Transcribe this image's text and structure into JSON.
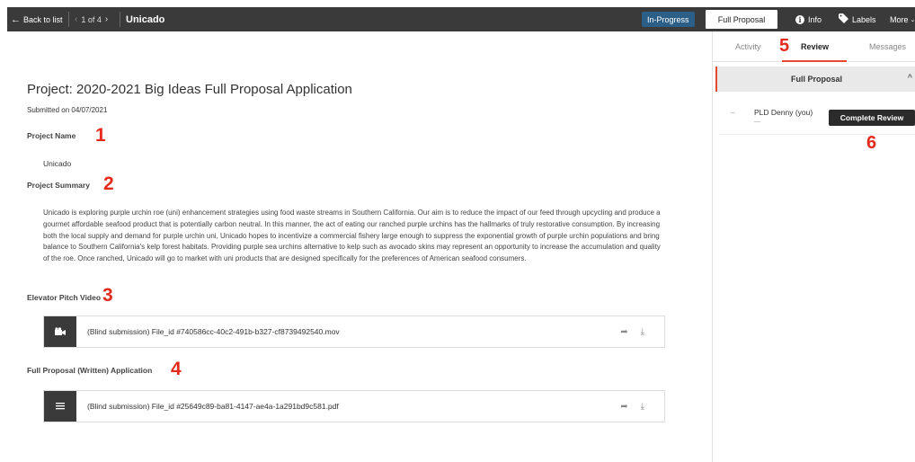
{
  "topbar": {
    "back_label": "Back to list",
    "pager_label": "1 of 4",
    "app_title": "Unicado",
    "status": "In-Progress",
    "full_proposal_label": "Full Proposal",
    "info_label": "Info",
    "labels_label": "Labels",
    "more_label": "More"
  },
  "content": {
    "title": "Project: 2020-2021 Big Ideas Full Proposal Application",
    "submitted": "Submitted on 04/07/2021",
    "project_name_heading": "Project Name",
    "project_name_value": "Unicado",
    "project_summary_heading": "Project Summary",
    "project_summary_text": "Unicado is exploring purple urchin roe (uni) enhancement strategies using food waste streams in Southern California. Our aim is to reduce the impact of our feed through upcycling and produce a gourmet affordable seafood product that is potentially carbon neutral. In this manner, the act of eating our ranched purple urchins has the hallmarks of truly restorative consumption. By increasing both the local supply and demand for purple urchin uni, Unicado hopes to incentivize a commercial fishery large enough to suppress the exponential growth of purple urchin populations and bring balance to Southern California's kelp forest habitats. Providing purple sea urchins alternative to kelp such as avocado skins may represent an opportunity to increase the accumulation and quality of the roe. Once ranched, Unicado will go to market with uni products that are designed specifically for the preferences of American seafood consumers.",
    "pitch_heading": "Elevator Pitch Video",
    "pitch_file": "(Blind submission) File_id #740586cc-40c2-491b-b327-cf8739492540.mov",
    "written_heading": "Full Proposal (Written) Application",
    "written_file": "(Blind submission) File_id #25649c89-ba81-4147-ae4a-1a291bd9c581.pdf"
  },
  "annotations": {
    "n1": "1",
    "n2": "2",
    "n3": "3",
    "n4": "4",
    "n5": "5",
    "n6": "6"
  },
  "panel": {
    "tabs": [
      "Activity",
      "Review",
      "Messages"
    ],
    "accordion_title": "Full Proposal",
    "reviewer_name": "PLD Denny (you)",
    "reviewer_dash": "–",
    "reviewer_sub": "—",
    "complete_review_label": "Complete Review"
  },
  "colors": {
    "topbar_bg": "#3a3a3a",
    "status_bg": "#2c5f87",
    "accent": "#e64a2e",
    "annotation_red": "#e32a1c"
  }
}
